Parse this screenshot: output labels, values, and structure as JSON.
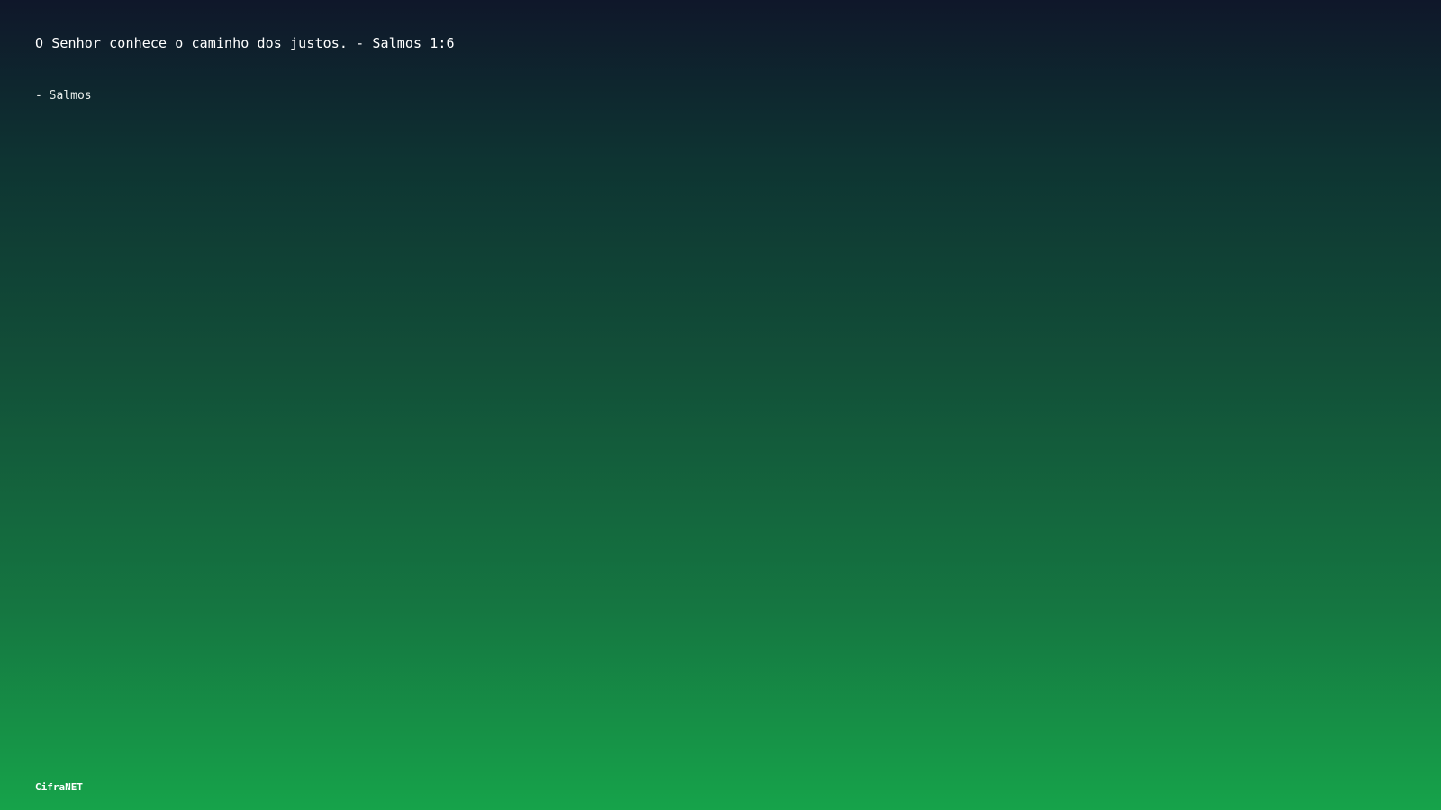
{
  "quote": {
    "text": "O Senhor conhece o caminho dos justos. - Salmos 1:6",
    "attribution": "- Salmos"
  },
  "footer": {
    "brand": "CifraNET"
  },
  "colors": {
    "background_top": "#0f172a",
    "background_bottom": "#16a34a",
    "text": "#ffffff"
  }
}
